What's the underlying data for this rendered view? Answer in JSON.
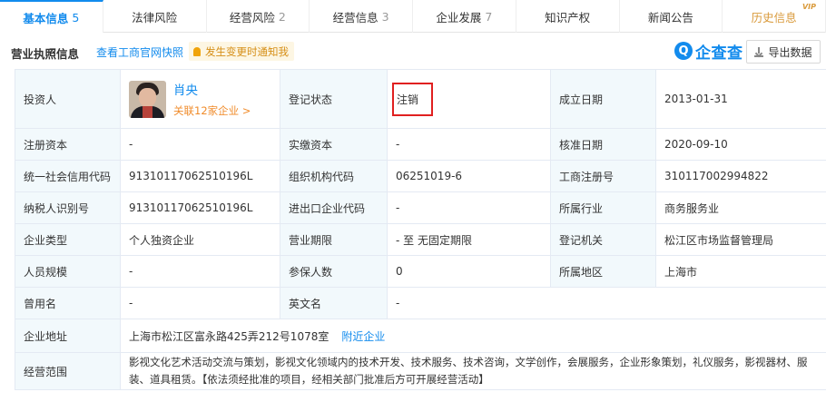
{
  "tabs": [
    {
      "label": "基本信息",
      "count": "5"
    },
    {
      "label": "法律风险",
      "count": ""
    },
    {
      "label": "经营风险",
      "count": "2"
    },
    {
      "label": "经营信息",
      "count": "3"
    },
    {
      "label": "企业发展",
      "count": "7"
    },
    {
      "label": "知识产权",
      "count": ""
    },
    {
      "label": "新闻公告",
      "count": ""
    },
    {
      "label": "历史信息",
      "count": "",
      "badge": "VIP"
    }
  ],
  "section": {
    "title": "营业执照信息",
    "snapshot_link": "查看工商官网快照",
    "notify": "发生变更时通知我",
    "brand": "企查查",
    "brand_glyph": "Q",
    "export_label": "导出数据"
  },
  "table": {
    "investor_label": "投资人",
    "investor_name": "肖央",
    "investor_related": "关联12家企业 >",
    "reg_status_label": "登记状态",
    "reg_status_value": "注销",
    "found_date_label": "成立日期",
    "found_date_value": "2013-01-31",
    "reg_capital_label": "注册资本",
    "reg_capital_value": "-",
    "paid_capital_label": "实缴资本",
    "paid_capital_value": "-",
    "approve_date_label": "核准日期",
    "approve_date_value": "2020-09-10",
    "credit_code_label": "统一社会信用代码",
    "credit_code_value": "91310117062510196L",
    "org_code_label": "组织机构代码",
    "org_code_value": "06251019-6",
    "biz_reg_no_label": "工商注册号",
    "biz_reg_no_value": "310117002994822",
    "taxpayer_id_label": "纳税人识别号",
    "taxpayer_id_value": "91310117062510196L",
    "import_export_label": "进出口企业代码",
    "import_export_value": "-",
    "industry_label": "所属行业",
    "industry_value": "商务服务业",
    "company_type_label": "企业类型",
    "company_type_value": "个人独资企业",
    "term_label": "营业期限",
    "term_value": "- 至 无固定期限",
    "reg_authority_label": "登记机关",
    "reg_authority_value": "松江区市场监督管理局",
    "staff_size_label": "人员规模",
    "staff_size_value": "-",
    "insured_label": "参保人数",
    "insured_value": "0",
    "region_label": "所属地区",
    "region_value": "上海市",
    "former_name_label": "曾用名",
    "former_name_value": "-",
    "english_name_label": "英文名",
    "english_name_value": "-",
    "address_label": "企业地址",
    "address_value": "上海市松江区富永路425弄212号1078室",
    "nearby_link": "附近企业",
    "scope_label": "经营范围",
    "scope_value": "影视文化艺术活动交流与策划，影视文化领域内的技术开发、技术服务、技术咨询，文学创作，会展服务，企业形象策划，礼仪服务，影视器材、服装、道具租赁。【依法须经批准的项目，经相关部门批准后方可开展经营活动】"
  }
}
